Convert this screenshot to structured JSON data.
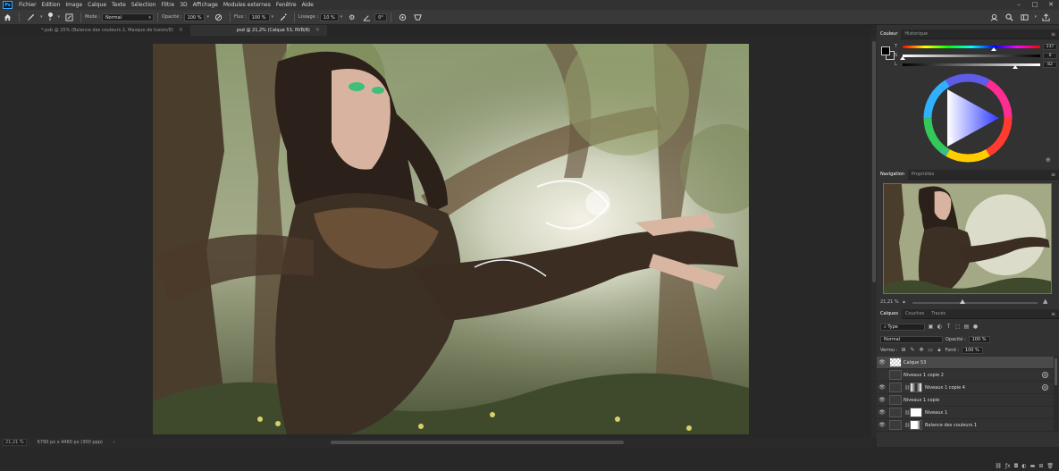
{
  "app": {
    "logo": "Ps"
  },
  "menu": [
    "Fichier",
    "Edition",
    "Image",
    "Calque",
    "Texte",
    "Sélection",
    "Filtre",
    "3D",
    "Affichage",
    "Modules externes",
    "Fenêtre",
    "Aide"
  ],
  "options": {
    "brush_size": "8",
    "mode_label": "Mode :",
    "mode_value": "Normal",
    "opacity_label": "Opacité :",
    "opacity_value": "100 %",
    "flux_label": "Flux :",
    "flux_value": "100 %",
    "smoothing_label": "Lissage :",
    "smoothing_value": "10 %",
    "angle_value": "0°"
  },
  "tabs": [
    {
      "label": "*.psb @ 25% (Balance des couleurs 2, Masque de fusion/8)",
      "active": false
    },
    {
      "label": "psd @ 21,2% (Calque 53, RVB/8)",
      "active": true
    }
  ],
  "status": {
    "zoom": "21,21 %",
    "doc_size": "6790 px x 4460 px (300 ppp)"
  },
  "color_panel": {
    "tabs": [
      "Couleur",
      "Historique"
    ],
    "hue_value": "237",
    "hue_unit": "°",
    "sat_value": "0",
    "sat_unit": "%",
    "bri_value": "82",
    "bri_unit": "%",
    "sliders": {
      "hue_frac": 0.66,
      "sat_frac": 0.0,
      "bri_frac": 0.82
    }
  },
  "navigator": {
    "tabs": [
      "Navigation",
      "Propriétés"
    ],
    "zoom": "21,21 %",
    "slider_frac": 0.4
  },
  "layers": {
    "tabs": [
      "Calques",
      "Couches",
      "Tracés"
    ],
    "filter_label": "Type",
    "blend_mode": "Normal",
    "opacity_label": "Opacité :",
    "opacity_value": "100 %",
    "lock_label": "Verrou :",
    "fill_label": "Fond :",
    "fill_value": "100 %",
    "rows": [
      {
        "name": "Calque 53",
        "selected": true
      },
      {
        "name": "Niveaux 1 copie 2",
        "selected": false
      },
      {
        "name": "Niveaux 1 copie 4",
        "selected": false
      },
      {
        "name": "Niveaux 1 copie",
        "selected": false
      },
      {
        "name": "Niveaux 1",
        "selected": false
      },
      {
        "name": "Balance des couleurs 1",
        "selected": false
      }
    ]
  }
}
